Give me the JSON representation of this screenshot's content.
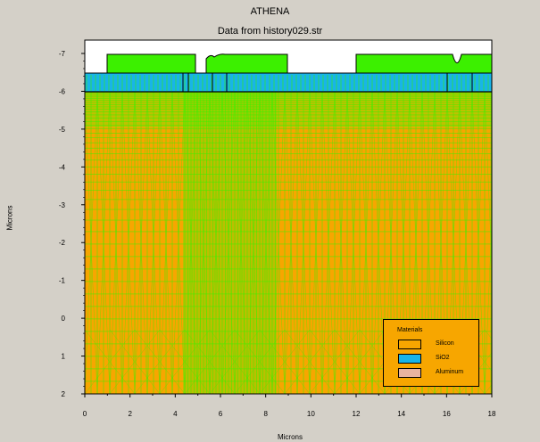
{
  "app_title": "ATHENA",
  "plot_title": "Data from history029.str",
  "x_axis_label": "Microns",
  "y_axis_label": "Microns",
  "x_ticks": [
    "0",
    "2",
    "4",
    "6",
    "8",
    "10",
    "12",
    "14",
    "16",
    "18"
  ],
  "y_ticks": [
    "-7",
    "-6",
    "-5",
    "-4",
    "-3",
    "-2",
    "-1",
    "0",
    "1",
    "2"
  ],
  "legend": {
    "title": "Materials",
    "items": [
      {
        "label": "Silicon",
        "color": "#f7a600"
      },
      {
        "label": "SiO2",
        "color": "#18b4e8"
      },
      {
        "label": "Aluminum",
        "color": "#e8b4a0"
      }
    ]
  },
  "colors": {
    "background": "#d4d0c8",
    "silicon": "#f7a600",
    "oxide": "#18b4e8",
    "mesh": "#3cf000",
    "plot_bg": "#ffffff"
  }
}
